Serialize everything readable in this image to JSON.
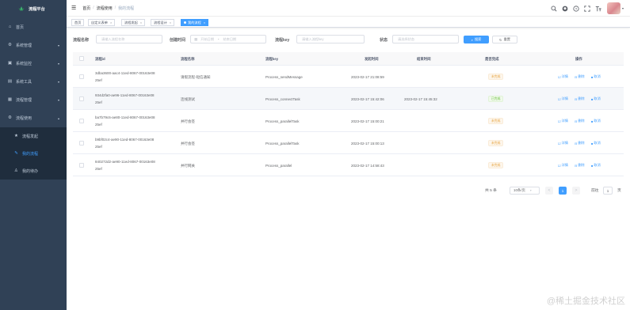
{
  "app": {
    "title": "流程平台"
  },
  "sidebar": {
    "items": [
      {
        "label": "首页",
        "icon": "home-icon"
      },
      {
        "label": "系统管理",
        "icon": "gear-icon"
      },
      {
        "label": "系统监控",
        "icon": "monitor-icon"
      },
      {
        "label": "系统工具",
        "icon": "tool-icon"
      },
      {
        "label": "流程管理",
        "icon": "flow-icon"
      },
      {
        "label": "流程使用",
        "icon": "gear-icon"
      }
    ],
    "subitems": [
      {
        "label": "流程发起",
        "icon": "star-icon"
      },
      {
        "label": "我的流程",
        "icon": "edit-icon"
      },
      {
        "label": "我的待办",
        "icon": "user-icon"
      }
    ]
  },
  "navbar": {
    "breadcrumb": [
      "首页",
      "流程使用",
      "我的流程"
    ]
  },
  "tags": [
    {
      "label": "首页"
    },
    {
      "label": "自定义表单"
    },
    {
      "label": "流程发起"
    },
    {
      "label": "流程设计"
    },
    {
      "label": "我的流程"
    }
  ],
  "search": {
    "name_label": "流程名称",
    "name_placeholder": "请输入流程名称",
    "time_label": "创建时间",
    "start_placeholder": "开始日期",
    "end_placeholder": "结束日期",
    "range_sep": "-",
    "key_label": "流程key",
    "key_placeholder": "请输入流程key",
    "status_label": "状态",
    "status_placeholder": "请选择状态",
    "search_btn": "搜索",
    "reset_btn": "重置"
  },
  "table": {
    "headers": [
      "流程id",
      "流程名称",
      "流程key",
      "发起时间",
      "结束时间",
      "是否完成",
      "操作"
    ],
    "rows": [
      {
        "id1": "3dba3600-aac4-11ed-8067-00163e08",
        "id2": "25ef",
        "name": "请假流程-短信通知",
        "key": "Process_sendMessage",
        "start": "2023-02-17 21:08:59",
        "end": "",
        "status": "未完成",
        "done": false
      },
      {
        "id1": "934d2fa0-ae96-11ed-8067-00163e08",
        "id2": "25ef",
        "name": "连线测试",
        "key": "Process_connectTask",
        "start": "2023-02-17 15:42:06",
        "end": "2023-02-17 15:45:32",
        "status": "已完成",
        "done": true
      },
      {
        "id1": "ba7b79c6-ae80-11ed-8067-00163e08",
        "id2": "25ef",
        "name": "并行会签",
        "key": "Process_parallelTask",
        "start": "2023-02-17 15:00:21",
        "end": "",
        "status": "未完成",
        "done": false
      },
      {
        "id1": "b9bf02c4-ae90-11ed-8067-00163e08",
        "id2": "25ef",
        "name": "并行会签",
        "key": "Process_parallelTask",
        "start": "2023-02-17 15:00:13",
        "end": "",
        "status": "未完成",
        "done": false
      },
      {
        "id1": "840272d2-ae90-11ed-8067-00163e08",
        "id2": "25ef",
        "name": "并行网关",
        "key": "Process_parallel",
        "start": "2023-02-17 14:58:43",
        "end": "",
        "status": "未完成",
        "done": false
      }
    ],
    "ops": {
      "detail": "详情",
      "delete": "删除",
      "cancel": "取消"
    }
  },
  "pagination": {
    "total": "共 5 条",
    "page_size": "10条/页",
    "prev": "<",
    "current": "1",
    "next": ">",
    "goto": "前往",
    "goto_value": "1",
    "page_suffix": "页"
  },
  "watermark": "@稀土掘金技术社区",
  "colors": {
    "sidebar": "#304156",
    "primary": "#409eff",
    "success": "#67c23a",
    "warning": "#e6a23c"
  }
}
